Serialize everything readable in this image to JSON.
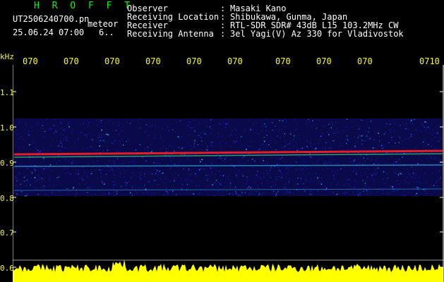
{
  "header": {
    "title": "H R O F F T",
    "file_name": "UT2506240700.pn",
    "mode": "meteor",
    "date_time": "25.06.24 07:00",
    "count": "6.."
  },
  "meta": [
    {
      "label": "Observer",
      "value": "Masaki Kano"
    },
    {
      "label": "Receiving Location",
      "value": "Shibukawa, Gunma, Japan"
    },
    {
      "label": "Receiver",
      "value": "RTL-SDR SDR# 43dB L15 103.2MHz CW"
    },
    {
      "label": "Receiving Antenna",
      "value": "3el Yagi(V) Az 330 for Vladivostok"
    }
  ],
  "axes": {
    "y_unit": "kHz",
    "y_ticks": [
      "1.1",
      "1.0",
      "0.9",
      "0.8",
      "0.7",
      "0.6"
    ],
    "time_ticks": [
      "070",
      "070",
      "070",
      "070",
      "070",
      "070",
      "070",
      "070",
      "070",
      "0710"
    ]
  },
  "colors": {
    "title": "#00ff00",
    "text": "#ffffff",
    "ticks": "#ffff00",
    "axis": "#ffffff",
    "background": "#000000",
    "signal": "#ff2020",
    "noise_low": "#1a1aa8",
    "noise_mid": "#3ad0ff",
    "power_trace": "#ffff00"
  }
}
